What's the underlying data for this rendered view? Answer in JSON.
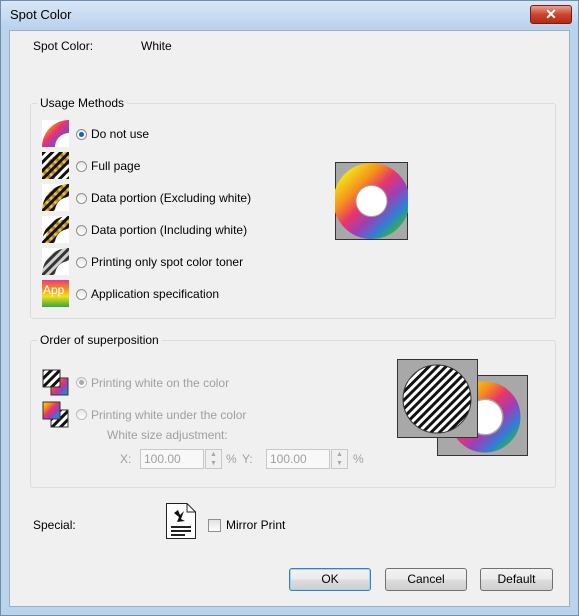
{
  "window": {
    "title": "Spot Color"
  },
  "spot_color": {
    "label": "Spot Color:",
    "value": "White"
  },
  "usage": {
    "legend": "Usage Methods",
    "options": [
      {
        "label": "Do not use",
        "checked": true
      },
      {
        "label": "Full page",
        "checked": false
      },
      {
        "label": "Data portion (Excluding white)",
        "checked": false
      },
      {
        "label": "Data portion (Including white)",
        "checked": false
      },
      {
        "label": "Printing only spot color toner",
        "checked": false
      },
      {
        "label": "Application specification",
        "checked": false
      }
    ],
    "app_thumb_text": "App"
  },
  "order": {
    "legend": "Order of superposition",
    "options": [
      {
        "label": "Printing white on the color",
        "checked": true,
        "enabled": false
      },
      {
        "label": "Printing white under the color",
        "checked": false,
        "enabled": false
      }
    ],
    "size_adjust_label": "White size adjustment:",
    "x_label": "X:",
    "x_value": "100.00",
    "x_unit": "%",
    "y_label": "Y:",
    "y_value": "100.00",
    "y_unit": "%"
  },
  "special": {
    "label": "Special:",
    "mirror_print_label": "Mirror Print",
    "mirror_print_checked": false
  },
  "buttons": {
    "ok": "OK",
    "cancel": "Cancel",
    "default": "Default"
  },
  "colors": {
    "title_bar": "#bcd3ec",
    "dialog_bg": "#f0f0f0",
    "close_button": "#c9452e",
    "radio_dot": "#1f5fb8",
    "disabled_text": "#a0a0a0"
  }
}
